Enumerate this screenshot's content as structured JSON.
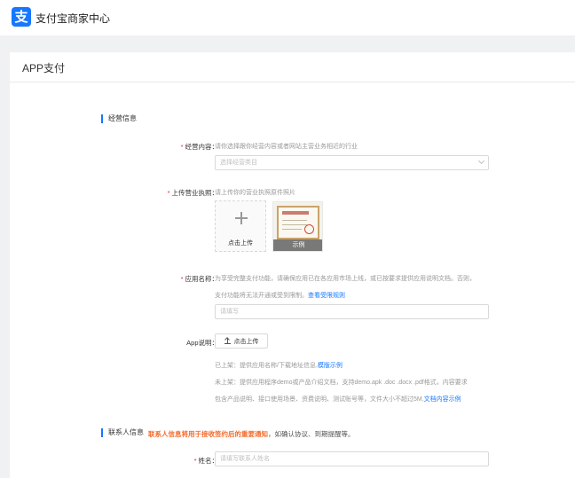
{
  "header": {
    "logo_glyph": "支",
    "brand": "支付宝商家中心",
    "brand_color": "#1677ff"
  },
  "page": {
    "title": "APP支付"
  },
  "sections": {
    "business": {
      "title": "经营信息"
    },
    "contact": {
      "title": "联系人信息",
      "warn": "联系人信息将用于接收签约后的重要通知",
      "note": "，如确认协议、到期提醒等。"
    }
  },
  "fields": {
    "content": {
      "label": "经营内容：",
      "hint": "请你选择跟你经营内容或者网站主营业务相近的行业",
      "placeholder": "选择经营类目"
    },
    "license": {
      "label": "上传营业执照：",
      "hint": "请上传你的营业执照原件照片",
      "upload_text": "点击上传",
      "sample_label": "示例"
    },
    "app_name": {
      "label": "应用名称：",
      "hint1": "为享受完整支付功能，请确保应用已在各应用市场上线，或已按要求提供应用说明文档。否则，",
      "hint2": "支付功能将无法开通或受到限制。",
      "hint2_link": "查看受限规则",
      "placeholder": "请填写"
    },
    "app_desc": {
      "label": "App说明：",
      "button": "点击上传",
      "online": "已上架：提供应用名称/下载地址信息,",
      "online_link": "模版示例",
      "offline1": "未上架：提供应用程序demo或产品介绍文档，支持demo.apk .doc .docx .pdf格式，内容要求",
      "offline2": "包含产品说明、接口使用场景、资费说明、测试账号等，文件大小不超过5M,",
      "offline2_link": "文档内容示例"
    },
    "name": {
      "label": "姓名：",
      "placeholder": "请填写联系人姓名"
    }
  }
}
